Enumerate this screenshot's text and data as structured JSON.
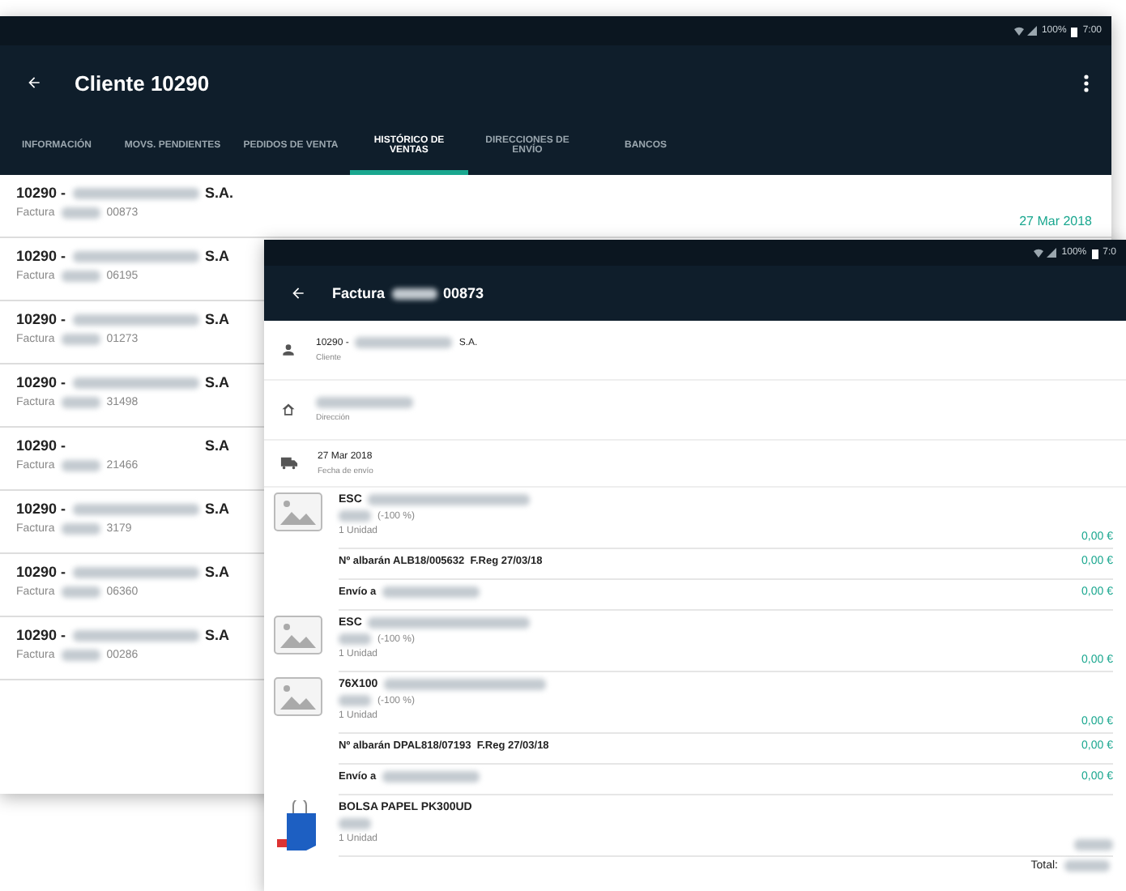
{
  "back_screen": {
    "status": {
      "battery": "100%",
      "time": "7:00"
    },
    "title": "Cliente 10290",
    "tabs": [
      {
        "label": "INFORMACIÓN",
        "selected": false
      },
      {
        "label": "MOVS. PENDIENTES",
        "selected": false
      },
      {
        "label": "PEDIDOS DE VENTA",
        "selected": false
      },
      {
        "label": "HISTÓRICO DE VENTAS",
        "selected": true
      },
      {
        "label": "DIRECCIONES DE ENVÍO",
        "selected": false
      },
      {
        "label": "BANCOS",
        "selected": false
      }
    ],
    "rows": [
      {
        "code": "10290 -",
        "redacted": true,
        "suffix": "S.A.",
        "doc": "Factura",
        "number": "00873",
        "date": "27 Mar 2018"
      },
      {
        "code": "10290 -",
        "redacted": true,
        "suffix": "S.A",
        "doc": "Factura",
        "number": "06195"
      },
      {
        "code": "10290 -",
        "redacted": true,
        "suffix": "S.A",
        "doc": "Factura",
        "number": "01273"
      },
      {
        "code": "10290 -",
        "redacted": true,
        "suffix": "S.A",
        "doc": "Factura",
        "number": "31498"
      },
      {
        "code": "10290 -",
        "redacted": false,
        "suffix": "S.A",
        "doc": "Factura",
        "number": "21466"
      },
      {
        "code": "10290 -",
        "redacted": true,
        "suffix": "S.A",
        "doc": "Factura",
        "number": "3179"
      },
      {
        "code": "10290 -",
        "redacted": true,
        "suffix": "S.A",
        "doc": "Factura",
        "number": "06360"
      },
      {
        "code": "10290 -",
        "redacted": true,
        "suffix": "S.A",
        "doc": "Factura",
        "number": "00286"
      }
    ]
  },
  "front_screen": {
    "status": {
      "battery": "100%",
      "time": "7:0"
    },
    "title": "Factura",
    "title_number": "00873",
    "info": [
      {
        "kind": "person",
        "value": "10290 -",
        "redacted": true,
        "suffix": "S.A.",
        "label": "Cliente"
      },
      {
        "kind": "home",
        "redacted": true,
        "label": "Dirección"
      },
      {
        "kind": "truck",
        "value": "27 Mar 2018",
        "redacted": false,
        "label": "Fecha de envío"
      }
    ],
    "lines": [
      {
        "kind": "product",
        "code": "ESC",
        "discount": "(-100 %)",
        "quantity": "1 Unidad",
        "price": "0,00 €"
      },
      {
        "kind": "note",
        "text": "Nº albarán ALB18/005632  F.Reg 27/03/18",
        "price": "0,00 €"
      },
      {
        "kind": "shipping",
        "text": "Envío a",
        "price": "0,00 €"
      },
      {
        "kind": "product",
        "code": "ESC",
        "discount": "(-100 %)",
        "quantity": "1 Unidad",
        "price": "0,00 €"
      },
      {
        "kind": "product",
        "code": "76X100",
        "discount": "(-100 %)",
        "quantity": "1 Unidad",
        "price": "0,00 €"
      },
      {
        "kind": "note",
        "text": "Nº albarán DPAL818/07193  F.Reg 27/03/18",
        "price": "0,00 €"
      },
      {
        "kind": "shipping",
        "text": "Envío a",
        "price": "0,00 €"
      },
      {
        "kind": "bag",
        "code": "BOLSA PAPEL PK300UD",
        "quantity": "1 Unidad"
      }
    ],
    "total_label": "Total:"
  }
}
